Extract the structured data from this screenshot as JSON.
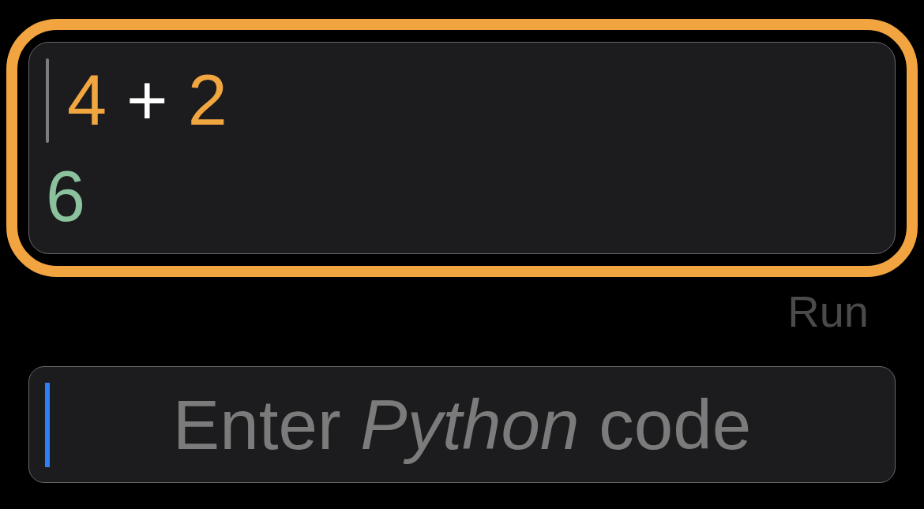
{
  "cells": [
    {
      "selected": true,
      "caret": true,
      "input": [
        {
          "text": "4",
          "kind": "number"
        },
        {
          "text": "+",
          "kind": "operator"
        },
        {
          "text": "2",
          "kind": "number"
        }
      ],
      "output": {
        "text": "6",
        "kind": "result"
      }
    }
  ],
  "run_button": {
    "label": "Run",
    "disabled": true
  },
  "code_input": {
    "placeholder": "Enter *Python* code",
    "focused": true
  }
}
